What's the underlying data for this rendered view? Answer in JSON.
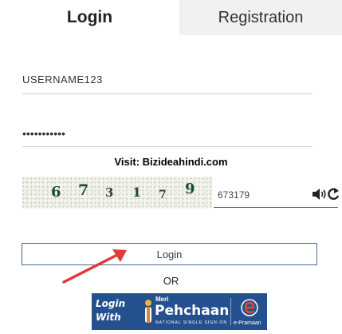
{
  "tabs": {
    "login": "Login",
    "registration": "Registration"
  },
  "form": {
    "username_value": "USERNAME123",
    "password_value": "•••••••••••",
    "visit_text": "Visit: Bizideahindi.com",
    "captcha_digits": [
      "6",
      "7",
      "3",
      "1",
      "7",
      "9"
    ],
    "captcha_input_value": "673179",
    "login_button": "Login",
    "or_text": "OR"
  },
  "meri_pehchaan": {
    "login_line1": "Login",
    "login_line2": "With",
    "meri": "Meri",
    "pehchaan": "Pehchaan",
    "subtitle": "NATIONAL SINGLE SIGN-ON",
    "e_pramaan": "e-Pramaan"
  },
  "colors": {
    "banner_bg": "#24508d",
    "button_border": "#4a6a8a",
    "arrow": "#e03a3a"
  }
}
